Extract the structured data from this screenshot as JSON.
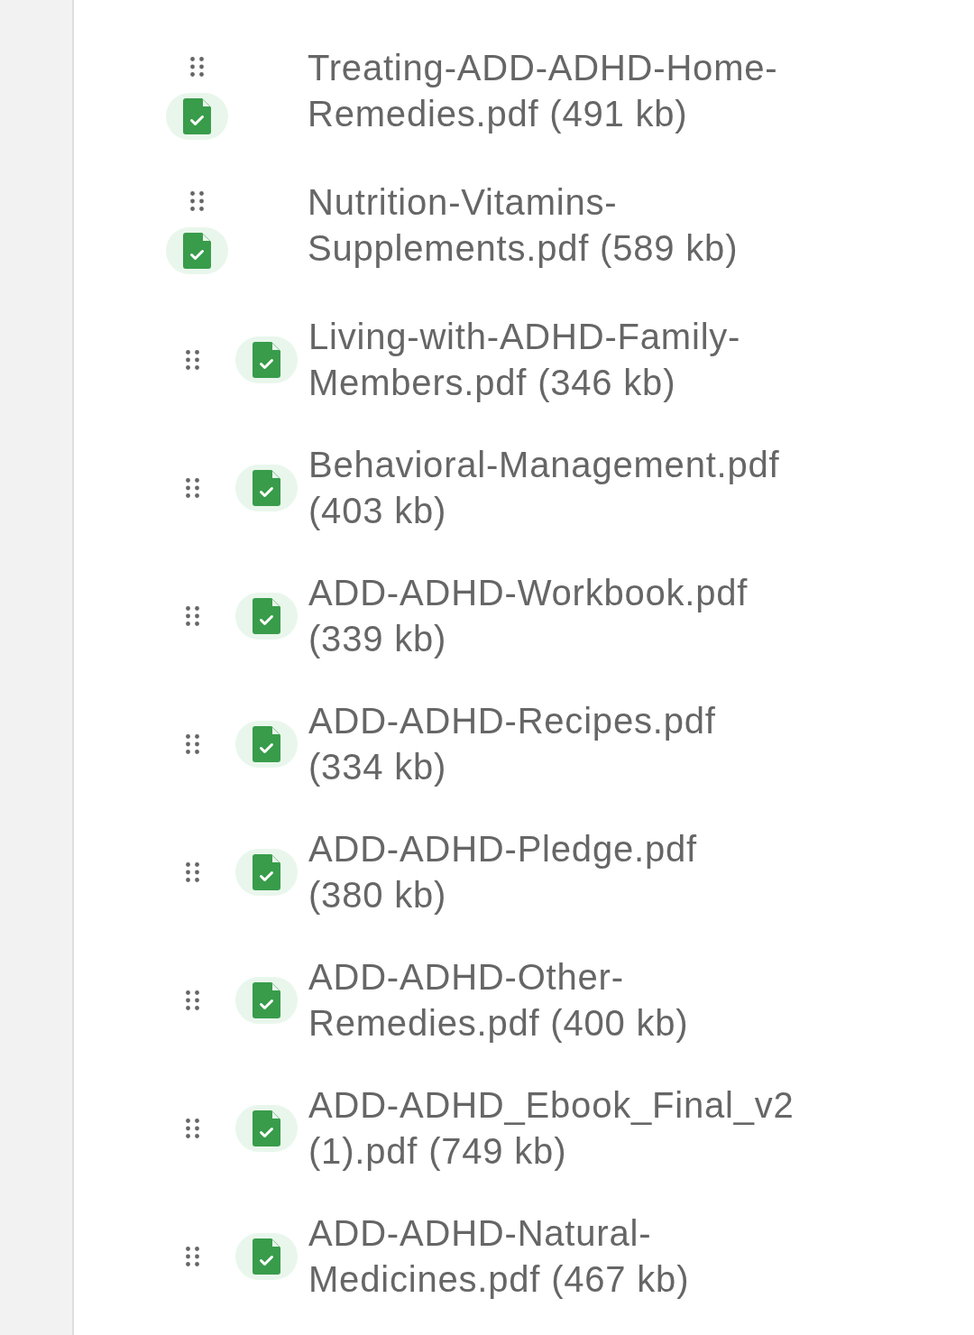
{
  "files": [
    {
      "kind": "stacked",
      "name": "Treating-ADD-ADHD-Home-Remedies.pdf",
      "size": "(491 kb)"
    },
    {
      "kind": "stacked",
      "name": "Nutrition-Vitamins-Supplements.pdf",
      "size": "(589 kb)"
    },
    {
      "kind": "inline",
      "name": "Living-with-ADHD-Family-Members.pdf",
      "size": "(346 kb)"
    },
    {
      "kind": "inline",
      "name": "Behavioral-Management.pdf",
      "size": "(403 kb)"
    },
    {
      "kind": "inline",
      "name": "ADD-ADHD-Workbook.pdf",
      "size": "(339 kb)"
    },
    {
      "kind": "inline",
      "name": "ADD-ADHD-Recipes.pdf",
      "size": "(334 kb)"
    },
    {
      "kind": "inline",
      "name": "ADD-ADHD-Pledge.pdf",
      "size": "(380 kb)"
    },
    {
      "kind": "inline",
      "name": "ADD-ADHD-Other-Remedies.pdf",
      "size": "(400 kb)"
    },
    {
      "kind": "inline",
      "name": "ADD-ADHD_Ebook_Final_v2 (1).pdf",
      "size": "(749 kb)"
    },
    {
      "kind": "inline",
      "name": "ADD-ADHD-Natural-Medicines.pdf",
      "size": "(467 kb)"
    }
  ]
}
